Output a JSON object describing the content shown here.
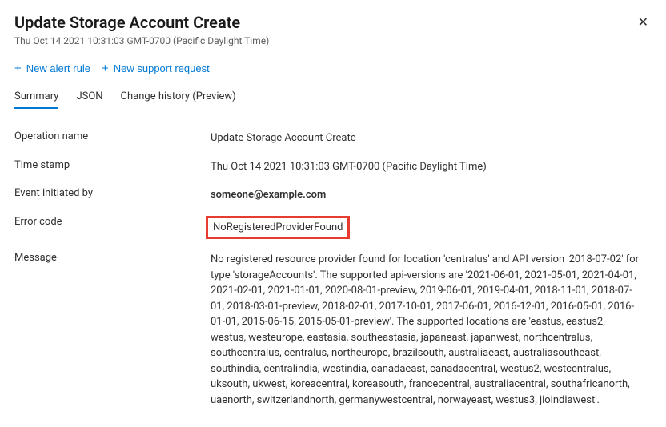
{
  "header": {
    "title": "Update Storage Account Create",
    "subtitle": "Thu Oct 14 2021 10:31:03 GMT-0700 (Pacific Daylight Time)"
  },
  "toolbar": {
    "new_alert_rule": "New alert rule",
    "new_support_request": "New support request"
  },
  "tabs": {
    "summary": "Summary",
    "json": "JSON",
    "change_history": "Change history (Preview)"
  },
  "details": {
    "operation_name": {
      "label": "Operation name",
      "value": "Update Storage Account Create"
    },
    "time_stamp": {
      "label": "Time stamp",
      "value": "Thu Oct 14 2021 10:31:03 GMT-0700 (Pacific Daylight Time)"
    },
    "event_initiated_by": {
      "label": "Event initiated by",
      "value": "someone@example.com"
    },
    "error_code": {
      "label": "Error code",
      "value": "NoRegisteredProviderFound"
    },
    "message": {
      "label": "Message",
      "value": "No registered resource provider found for location 'centralus' and API version '2018-07-02' for type 'storageAccounts'. The supported api-versions are '2021-06-01, 2021-05-01, 2021-04-01, 2021-02-01, 2021-01-01, 2020-08-01-preview, 2019-06-01, 2019-04-01, 2018-11-01, 2018-07-01, 2018-03-01-preview, 2018-02-01, 2017-10-01, 2017-06-01, 2016-12-01, 2016-05-01, 2016-01-01, 2015-06-15, 2015-05-01-preview'. The supported locations are 'eastus, eastus2, westus, westeurope, eastasia, southeastasia, japaneast, japanwest, northcentralus, southcentralus, centralus, northeurope, brazilsouth, australiaeast, australiasoutheast, southindia, centralindia, westindia, canadaeast, canadacentral, westus2, westcentralus, uksouth, ukwest, koreacentral, koreasouth, francecentral, australiacentral, southafricanorth, uaenorth, switzerlandnorth, germanywestcentral, norwayeast, westus3, jioindiawest'."
    }
  }
}
